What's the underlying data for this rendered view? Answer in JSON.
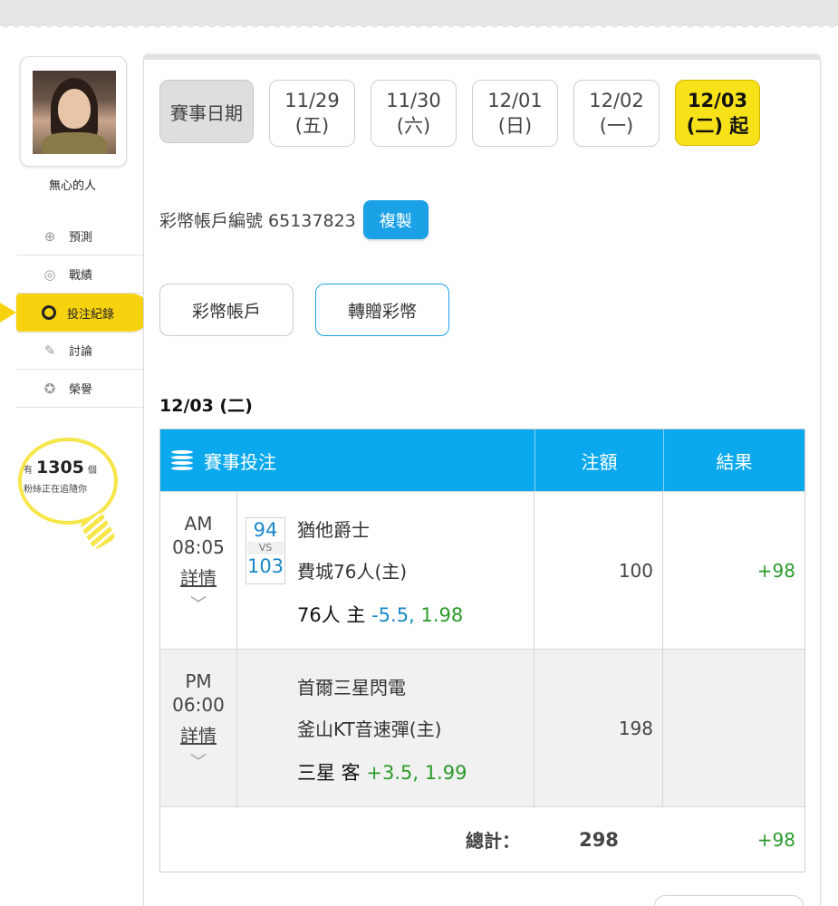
{
  "user": {
    "name": "無心的人"
  },
  "menu": [
    {
      "label": "預測",
      "icon": "crosshair-icon",
      "glyph": "⊕",
      "active": false
    },
    {
      "label": "戰績",
      "icon": "record-icon",
      "glyph": "◎",
      "active": false
    },
    {
      "label": "投注紀錄",
      "icon": "circle-icon",
      "glyph": "○",
      "active": true
    },
    {
      "label": "討論",
      "icon": "discussion-icon",
      "glyph": "✎",
      "active": false
    },
    {
      "label": "榮譽",
      "icon": "medal-icon",
      "glyph": "✪",
      "active": false
    }
  ],
  "fans": {
    "prefix": "有",
    "count": "1305",
    "suffix": "個",
    "sub": "粉絲正在追隨你"
  },
  "dates": {
    "label": "賽事日期",
    "items": [
      {
        "date": "11/29",
        "weekday": "(五)"
      },
      {
        "date": "11/30",
        "weekday": "(六)"
      },
      {
        "date": "12/01",
        "weekday": "(日)"
      },
      {
        "date": "12/02",
        "weekday": "(一)"
      },
      {
        "date": "12/03",
        "weekday": "(二) 起"
      }
    ]
  },
  "account": {
    "label": "彩幣帳戶編號 65137823",
    "copy_label": "複製"
  },
  "actions": {
    "account_label": "彩幣帳戶",
    "transfer_label": "轉贈彩幣"
  },
  "day_heading": "12/03 (二)",
  "table": {
    "head_main": "賽事投注",
    "head_amount": "注額",
    "head_result": "結果",
    "rows": [
      {
        "ampm": "AM",
        "time": "08:05",
        "detail": "詳情",
        "score_away": "94",
        "vs": "VS",
        "score_home": "103",
        "team_away": "猶他爵士",
        "team_home": "費城76人(主)",
        "pick_team": "76人 主",
        "pick_line": "-5.5",
        "pick_sep": ",",
        "pick_odds": "1.98",
        "amount": "100",
        "result": "+98"
      },
      {
        "ampm": "PM",
        "time": "06:00",
        "detail": "詳情",
        "team_away": "首爾三星閃電",
        "team_home": "釜山KT音速彈(主)",
        "pick_team": "三星 客",
        "pick_line": "+3.5",
        "pick_sep": ",",
        "pick_odds": "1.99",
        "amount": "198",
        "result": ""
      }
    ],
    "total_label": "總計：",
    "total_amount": "298",
    "total_result": "+98"
  },
  "colors": {
    "accent_blue": "#0aa8ec",
    "accent_yellow": "#f7e21a",
    "win_green": "#2a9a2a"
  }
}
